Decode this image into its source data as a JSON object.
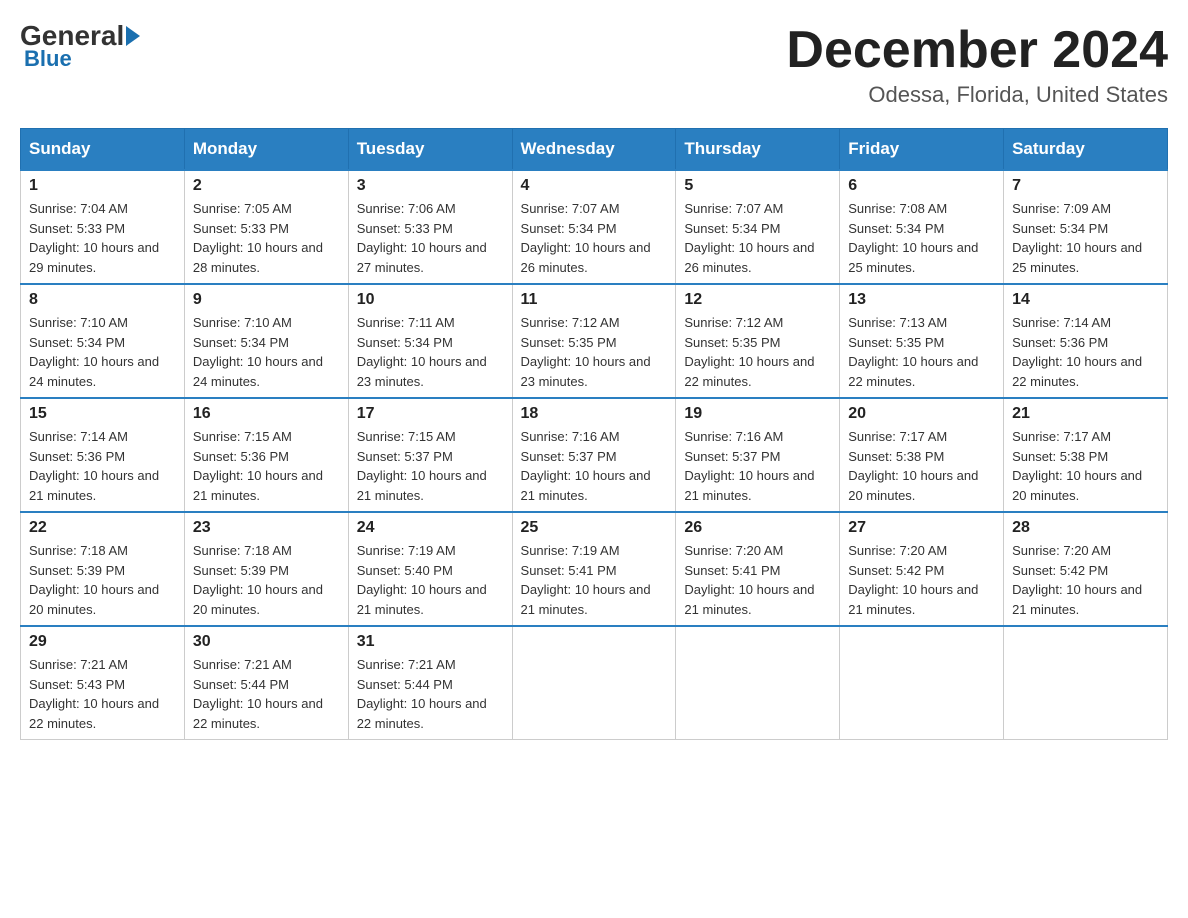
{
  "logo": {
    "general": "General",
    "blue": "Blue"
  },
  "title": "December 2024",
  "location": "Odessa, Florida, United States",
  "days_of_week": [
    "Sunday",
    "Monday",
    "Tuesday",
    "Wednesday",
    "Thursday",
    "Friday",
    "Saturday"
  ],
  "weeks": [
    [
      {
        "day": "1",
        "sunrise": "7:04 AM",
        "sunset": "5:33 PM",
        "daylight": "10 hours and 29 minutes."
      },
      {
        "day": "2",
        "sunrise": "7:05 AM",
        "sunset": "5:33 PM",
        "daylight": "10 hours and 28 minutes."
      },
      {
        "day": "3",
        "sunrise": "7:06 AM",
        "sunset": "5:33 PM",
        "daylight": "10 hours and 27 minutes."
      },
      {
        "day": "4",
        "sunrise": "7:07 AM",
        "sunset": "5:34 PM",
        "daylight": "10 hours and 26 minutes."
      },
      {
        "day": "5",
        "sunrise": "7:07 AM",
        "sunset": "5:34 PM",
        "daylight": "10 hours and 26 minutes."
      },
      {
        "day": "6",
        "sunrise": "7:08 AM",
        "sunset": "5:34 PM",
        "daylight": "10 hours and 25 minutes."
      },
      {
        "day": "7",
        "sunrise": "7:09 AM",
        "sunset": "5:34 PM",
        "daylight": "10 hours and 25 minutes."
      }
    ],
    [
      {
        "day": "8",
        "sunrise": "7:10 AM",
        "sunset": "5:34 PM",
        "daylight": "10 hours and 24 minutes."
      },
      {
        "day": "9",
        "sunrise": "7:10 AM",
        "sunset": "5:34 PM",
        "daylight": "10 hours and 24 minutes."
      },
      {
        "day": "10",
        "sunrise": "7:11 AM",
        "sunset": "5:34 PM",
        "daylight": "10 hours and 23 minutes."
      },
      {
        "day": "11",
        "sunrise": "7:12 AM",
        "sunset": "5:35 PM",
        "daylight": "10 hours and 23 minutes."
      },
      {
        "day": "12",
        "sunrise": "7:12 AM",
        "sunset": "5:35 PM",
        "daylight": "10 hours and 22 minutes."
      },
      {
        "day": "13",
        "sunrise": "7:13 AM",
        "sunset": "5:35 PM",
        "daylight": "10 hours and 22 minutes."
      },
      {
        "day": "14",
        "sunrise": "7:14 AM",
        "sunset": "5:36 PM",
        "daylight": "10 hours and 22 minutes."
      }
    ],
    [
      {
        "day": "15",
        "sunrise": "7:14 AM",
        "sunset": "5:36 PM",
        "daylight": "10 hours and 21 minutes."
      },
      {
        "day": "16",
        "sunrise": "7:15 AM",
        "sunset": "5:36 PM",
        "daylight": "10 hours and 21 minutes."
      },
      {
        "day": "17",
        "sunrise": "7:15 AM",
        "sunset": "5:37 PM",
        "daylight": "10 hours and 21 minutes."
      },
      {
        "day": "18",
        "sunrise": "7:16 AM",
        "sunset": "5:37 PM",
        "daylight": "10 hours and 21 minutes."
      },
      {
        "day": "19",
        "sunrise": "7:16 AM",
        "sunset": "5:37 PM",
        "daylight": "10 hours and 21 minutes."
      },
      {
        "day": "20",
        "sunrise": "7:17 AM",
        "sunset": "5:38 PM",
        "daylight": "10 hours and 20 minutes."
      },
      {
        "day": "21",
        "sunrise": "7:17 AM",
        "sunset": "5:38 PM",
        "daylight": "10 hours and 20 minutes."
      }
    ],
    [
      {
        "day": "22",
        "sunrise": "7:18 AM",
        "sunset": "5:39 PM",
        "daylight": "10 hours and 20 minutes."
      },
      {
        "day": "23",
        "sunrise": "7:18 AM",
        "sunset": "5:39 PM",
        "daylight": "10 hours and 20 minutes."
      },
      {
        "day": "24",
        "sunrise": "7:19 AM",
        "sunset": "5:40 PM",
        "daylight": "10 hours and 21 minutes."
      },
      {
        "day": "25",
        "sunrise": "7:19 AM",
        "sunset": "5:41 PM",
        "daylight": "10 hours and 21 minutes."
      },
      {
        "day": "26",
        "sunrise": "7:20 AM",
        "sunset": "5:41 PM",
        "daylight": "10 hours and 21 minutes."
      },
      {
        "day": "27",
        "sunrise": "7:20 AM",
        "sunset": "5:42 PM",
        "daylight": "10 hours and 21 minutes."
      },
      {
        "day": "28",
        "sunrise": "7:20 AM",
        "sunset": "5:42 PM",
        "daylight": "10 hours and 21 minutes."
      }
    ],
    [
      {
        "day": "29",
        "sunrise": "7:21 AM",
        "sunset": "5:43 PM",
        "daylight": "10 hours and 22 minutes."
      },
      {
        "day": "30",
        "sunrise": "7:21 AM",
        "sunset": "5:44 PM",
        "daylight": "10 hours and 22 minutes."
      },
      {
        "day": "31",
        "sunrise": "7:21 AM",
        "sunset": "5:44 PM",
        "daylight": "10 hours and 22 minutes."
      },
      null,
      null,
      null,
      null
    ]
  ]
}
